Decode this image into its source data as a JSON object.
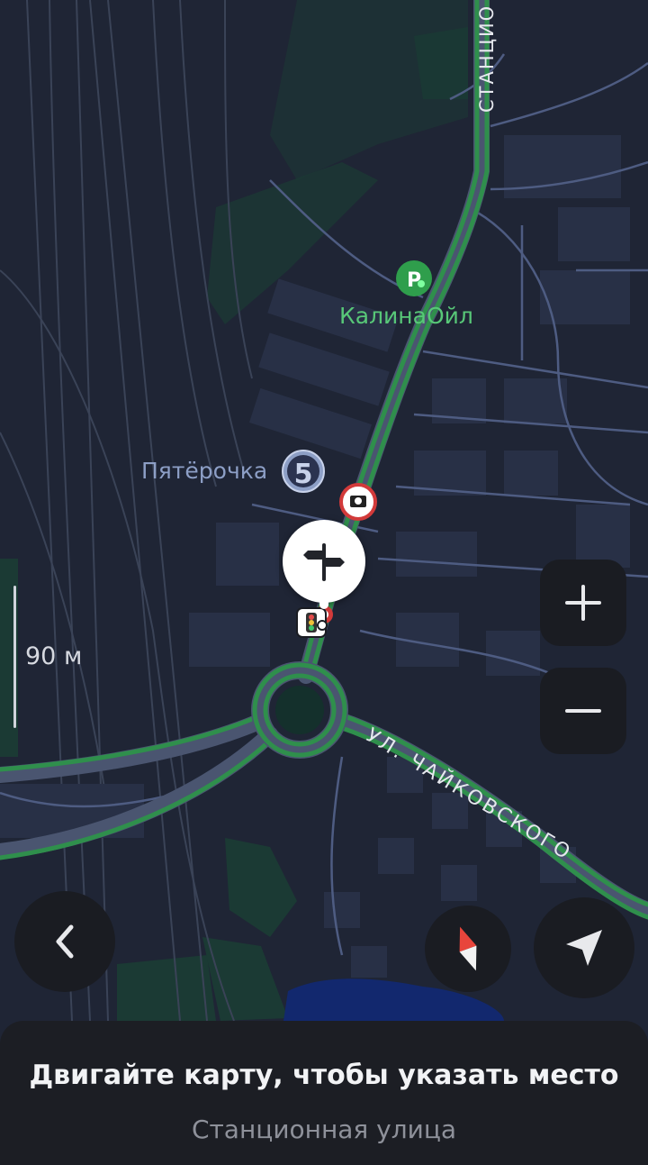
{
  "map": {
    "labels": {
      "street_top": "СТАНЦИО",
      "street_main": "УЛ. ЧАЙКОВСКОГО"
    },
    "pois": [
      {
        "name": "КалинаОйл",
        "icon": "gas-station-icon",
        "color": "#58c878"
      },
      {
        "name": "Пятёрочка",
        "icon": "pyaterochka-logo-icon",
        "color": "#8d9fc6"
      }
    ],
    "markers": [
      "traffic-camera-icon",
      "traffic-light-icon",
      "signpost-icon"
    ],
    "scale": "90 м",
    "colors": {
      "background": "#1f2535",
      "road_traffic": "#2f8f4c",
      "water": "#12286e",
      "park": "#1b3a34"
    }
  },
  "controls": {
    "zoom_in": "+",
    "zoom_out": "−",
    "back": "back-icon",
    "compass": "compass-icon",
    "locate": "locate-arrow-icon"
  },
  "bottom_sheet": {
    "title": "Двигайте карту, чтобы указать место",
    "subtitle": "Станционная улица"
  }
}
